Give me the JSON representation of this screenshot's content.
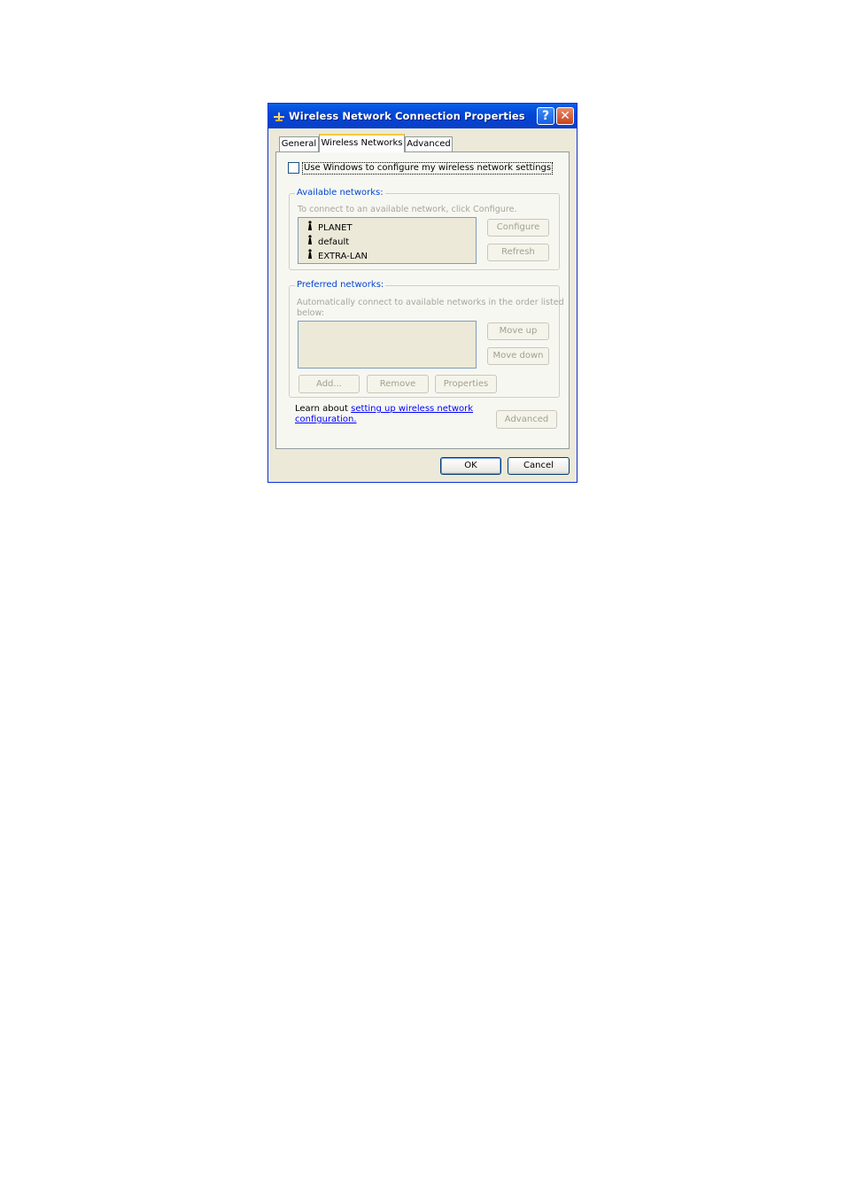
{
  "window": {
    "title": "Wireless Network Connection Properties",
    "help_label": "?",
    "close_label": "✕"
  },
  "tabs": [
    {
      "label": "General"
    },
    {
      "label": "Wireless Networks"
    },
    {
      "label": "Advanced"
    }
  ],
  "use_windows_checkbox": {
    "label": "Use Windows to configure my wireless network settings",
    "checked": false
  },
  "available_networks": {
    "legend": "Available networks:",
    "hint": "To connect to an available network, click Configure.",
    "items": [
      "PLANET",
      "default",
      "EXTRA-LAN"
    ],
    "configure_label": "Configure",
    "refresh_label": "Refresh"
  },
  "preferred_networks": {
    "legend": "Preferred networks:",
    "hint_line1": "Automatically connect to available networks in the order listed",
    "hint_line2": "below:",
    "move_up_label": "Move up",
    "move_down_label": "Move down",
    "add_label": "Add...",
    "remove_label": "Remove",
    "properties_label": "Properties"
  },
  "learn_about": {
    "prefix": "Learn about ",
    "link_line1": "setting up wireless network",
    "link_line2": "configuration."
  },
  "advanced_button_label": "Advanced",
  "ok_label": "OK",
  "cancel_label": "Cancel",
  "icons": {
    "window_icon": "network-connection-icon",
    "network_icon": "wireless-antenna-icon"
  }
}
